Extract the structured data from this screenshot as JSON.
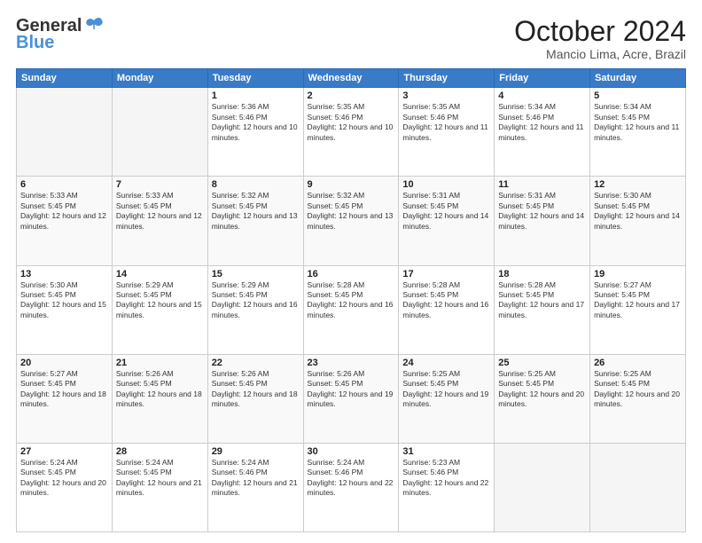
{
  "logo": {
    "line1": "General",
    "line2": "Blue"
  },
  "title": "October 2024",
  "location": "Mancio Lima, Acre, Brazil",
  "weekdays": [
    "Sunday",
    "Monday",
    "Tuesday",
    "Wednesday",
    "Thursday",
    "Friday",
    "Saturday"
  ],
  "weeks": [
    [
      {
        "day": "",
        "empty": true
      },
      {
        "day": "",
        "empty": true
      },
      {
        "day": "1",
        "sunrise": "5:36 AM",
        "sunset": "5:46 PM",
        "daylight": "12 hours and 10 minutes."
      },
      {
        "day": "2",
        "sunrise": "5:35 AM",
        "sunset": "5:46 PM",
        "daylight": "12 hours and 10 minutes."
      },
      {
        "day": "3",
        "sunrise": "5:35 AM",
        "sunset": "5:46 PM",
        "daylight": "12 hours and 11 minutes."
      },
      {
        "day": "4",
        "sunrise": "5:34 AM",
        "sunset": "5:46 PM",
        "daylight": "12 hours and 11 minutes."
      },
      {
        "day": "5",
        "sunrise": "5:34 AM",
        "sunset": "5:45 PM",
        "daylight": "12 hours and 11 minutes."
      }
    ],
    [
      {
        "day": "6",
        "sunrise": "5:33 AM",
        "sunset": "5:45 PM",
        "daylight": "12 hours and 12 minutes."
      },
      {
        "day": "7",
        "sunrise": "5:33 AM",
        "sunset": "5:45 PM",
        "daylight": "12 hours and 12 minutes."
      },
      {
        "day": "8",
        "sunrise": "5:32 AM",
        "sunset": "5:45 PM",
        "daylight": "12 hours and 13 minutes."
      },
      {
        "day": "9",
        "sunrise": "5:32 AM",
        "sunset": "5:45 PM",
        "daylight": "12 hours and 13 minutes."
      },
      {
        "day": "10",
        "sunrise": "5:31 AM",
        "sunset": "5:45 PM",
        "daylight": "12 hours and 14 minutes."
      },
      {
        "day": "11",
        "sunrise": "5:31 AM",
        "sunset": "5:45 PM",
        "daylight": "12 hours and 14 minutes."
      },
      {
        "day": "12",
        "sunrise": "5:30 AM",
        "sunset": "5:45 PM",
        "daylight": "12 hours and 14 minutes."
      }
    ],
    [
      {
        "day": "13",
        "sunrise": "5:30 AM",
        "sunset": "5:45 PM",
        "daylight": "12 hours and 15 minutes."
      },
      {
        "day": "14",
        "sunrise": "5:29 AM",
        "sunset": "5:45 PM",
        "daylight": "12 hours and 15 minutes."
      },
      {
        "day": "15",
        "sunrise": "5:29 AM",
        "sunset": "5:45 PM",
        "daylight": "12 hours and 16 minutes."
      },
      {
        "day": "16",
        "sunrise": "5:28 AM",
        "sunset": "5:45 PM",
        "daylight": "12 hours and 16 minutes."
      },
      {
        "day": "17",
        "sunrise": "5:28 AM",
        "sunset": "5:45 PM",
        "daylight": "12 hours and 16 minutes."
      },
      {
        "day": "18",
        "sunrise": "5:28 AM",
        "sunset": "5:45 PM",
        "daylight": "12 hours and 17 minutes."
      },
      {
        "day": "19",
        "sunrise": "5:27 AM",
        "sunset": "5:45 PM",
        "daylight": "12 hours and 17 minutes."
      }
    ],
    [
      {
        "day": "20",
        "sunrise": "5:27 AM",
        "sunset": "5:45 PM",
        "daylight": "12 hours and 18 minutes."
      },
      {
        "day": "21",
        "sunrise": "5:26 AM",
        "sunset": "5:45 PM",
        "daylight": "12 hours and 18 minutes."
      },
      {
        "day": "22",
        "sunrise": "5:26 AM",
        "sunset": "5:45 PM",
        "daylight": "12 hours and 18 minutes."
      },
      {
        "day": "23",
        "sunrise": "5:26 AM",
        "sunset": "5:45 PM",
        "daylight": "12 hours and 19 minutes."
      },
      {
        "day": "24",
        "sunrise": "5:25 AM",
        "sunset": "5:45 PM",
        "daylight": "12 hours and 19 minutes."
      },
      {
        "day": "25",
        "sunrise": "5:25 AM",
        "sunset": "5:45 PM",
        "daylight": "12 hours and 20 minutes."
      },
      {
        "day": "26",
        "sunrise": "5:25 AM",
        "sunset": "5:45 PM",
        "daylight": "12 hours and 20 minutes."
      }
    ],
    [
      {
        "day": "27",
        "sunrise": "5:24 AM",
        "sunset": "5:45 PM",
        "daylight": "12 hours and 20 minutes."
      },
      {
        "day": "28",
        "sunrise": "5:24 AM",
        "sunset": "5:45 PM",
        "daylight": "12 hours and 21 minutes."
      },
      {
        "day": "29",
        "sunrise": "5:24 AM",
        "sunset": "5:46 PM",
        "daylight": "12 hours and 21 minutes."
      },
      {
        "day": "30",
        "sunrise": "5:24 AM",
        "sunset": "5:46 PM",
        "daylight": "12 hours and 22 minutes."
      },
      {
        "day": "31",
        "sunrise": "5:23 AM",
        "sunset": "5:46 PM",
        "daylight": "12 hours and 22 minutes."
      },
      {
        "day": "",
        "empty": true
      },
      {
        "day": "",
        "empty": true
      }
    ]
  ]
}
